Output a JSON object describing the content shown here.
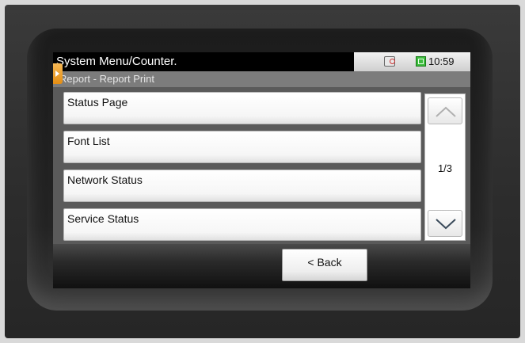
{
  "header": {
    "title": "System Menu/Counter.",
    "subtitle": "Report - Report Print",
    "time": "10:59",
    "icons": {
      "status_fax": "fax-status-icon",
      "clock": "clock-icon"
    }
  },
  "menu": {
    "items": [
      {
        "label": "Status Page"
      },
      {
        "label": "Font List"
      },
      {
        "label": "Network Status"
      },
      {
        "label": "Service Status"
      }
    ]
  },
  "pager": {
    "page": "1/3",
    "up_icon": "chevron-up-icon",
    "down_icon": "chevron-down-icon"
  },
  "footer": {
    "back_label": "< Back"
  },
  "colors": {
    "accent": "#e89a24",
    "clock_green": "#3dbb3d"
  }
}
